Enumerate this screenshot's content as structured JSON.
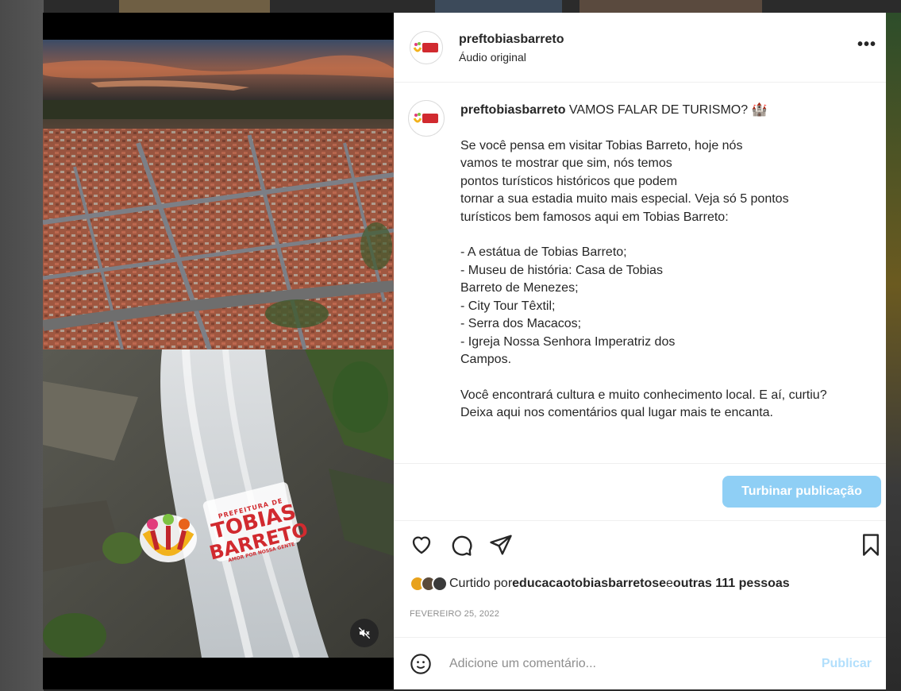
{
  "header": {
    "username": "preftobiasbarreto",
    "subtitle": "Áudio original",
    "more_icon": "•••"
  },
  "caption": {
    "username": "preftobiasbarreto",
    "headline": " VAMOS FALAR DE TURISMO? 🏰",
    "paragraph1": "Se você pensa em visitar Tobias Barreto, hoje nós\nvamos te mostrar que sim, nós temos\npontos turísticos históricos que podem\ntornar a sua estadia muito mais especial. Veja só 5 pontos\nturísticos bem famosos aqui em Tobias Barreto:",
    "paragraph2": "- A estátua de Tobias Barreto;\n- Museu de história: Casa de Tobias\nBarreto de Menezes;\n- City Tour Têxtil;\n- Serra dos Macacos;\n- Igreja Nossa Senhora Imperatriz dos\nCampos.",
    "paragraph3": "Você encontrará cultura e muito conhecimento local. E aí, curtiu?\nDeixa aqui nos comentários qual lugar mais te encanta."
  },
  "boost": {
    "label": "Turbinar publicação"
  },
  "likes": {
    "prefix": "Curtido por ",
    "user": "educacaotobiasbarretose",
    "middle": " e ",
    "others": "outras 111 pessoas"
  },
  "date": "FEVEREIRO 25, 2022",
  "comment": {
    "placeholder": "Adicione um comentário...",
    "publish_label": "Publicar"
  },
  "media": {
    "logo_line1": "PREFEITURA DE",
    "logo_line2": "TOBIAS",
    "logo_line3": "BARRETO",
    "logo_line4": "AMOR POR NOSSA GENTE"
  },
  "colors": {
    "boost_button": "#8fcff5",
    "publish_disabled": "#b2dffc",
    "text": "#262626",
    "muted": "#8e8e8e",
    "logo_red": "#d12a2f"
  }
}
